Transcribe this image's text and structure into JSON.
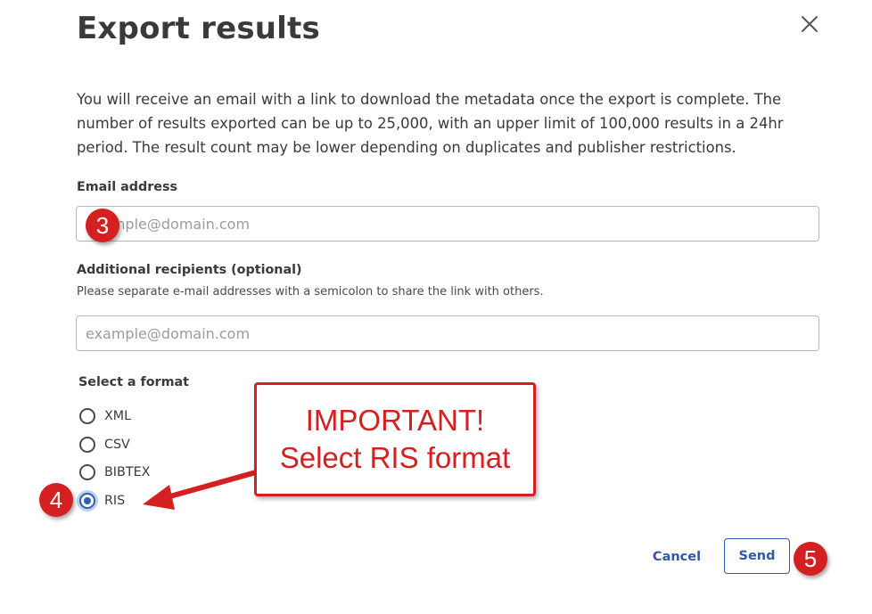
{
  "dialog": {
    "title": "Export results",
    "description": "You will receive an email with a link to download the metadata once the export is complete. The number of results exported can be up to 25,000, with an upper limit of 100,000 results in a 24hr period. The result count may be lower depending on duplicates and publisher restrictions.",
    "close_icon": "close-icon"
  },
  "email": {
    "label": "Email address",
    "placeholder": "example@domain.com",
    "value": ""
  },
  "recipients": {
    "label": "Additional recipients (optional)",
    "hint": "Please separate e-mail addresses with a semicolon to share the link with others.",
    "placeholder": "example@domain.com",
    "value": ""
  },
  "format": {
    "label": "Select a format",
    "options": [
      {
        "label": "XML",
        "checked": false
      },
      {
        "label": "CSV",
        "checked": false
      },
      {
        "label": "BIBTEX",
        "checked": false
      },
      {
        "label": "RIS",
        "checked": true
      }
    ],
    "selected": "RIS"
  },
  "actions": {
    "cancel_label": "Cancel",
    "send_label": "Send"
  },
  "annotations": {
    "step3": "3",
    "step4": "4",
    "step5": "5",
    "callout_line1": "IMPORTANT!",
    "callout_line2": "Select RIS format",
    "color": "#d42020"
  }
}
